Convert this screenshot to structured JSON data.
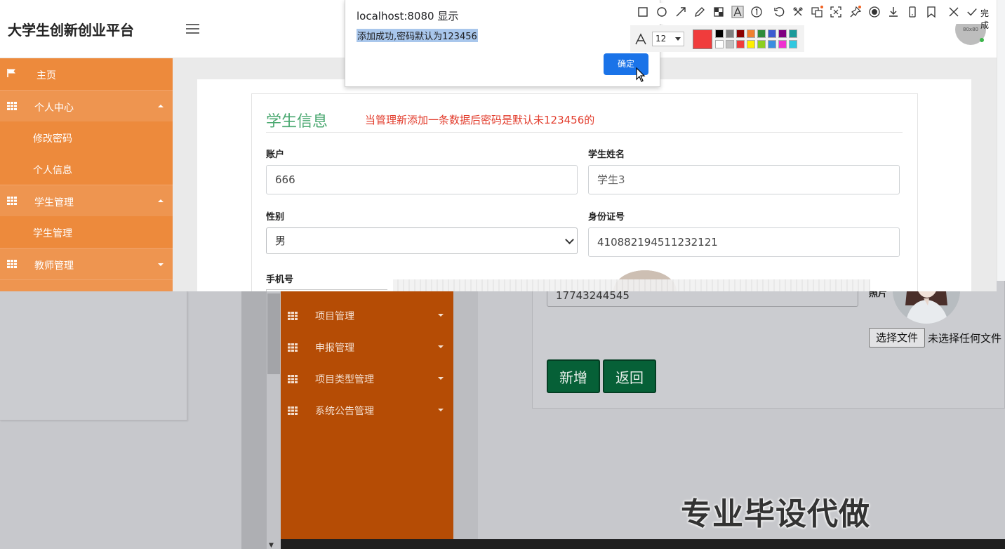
{
  "brand": "大学生创新创业平台",
  "avatar_text": "80x80",
  "sidebar": {
    "items": [
      {
        "label": "主页",
        "type": "head",
        "icon": "flag-icon"
      },
      {
        "label": "个人中心",
        "type": "head",
        "icon": "grid-icon",
        "caret": "up"
      },
      {
        "label": "修改密码",
        "type": "sub"
      },
      {
        "label": "个人信息",
        "type": "sub"
      },
      {
        "label": "学生管理",
        "type": "head",
        "icon": "grid-icon",
        "caret": "up"
      },
      {
        "label": "学生管理",
        "type": "sub"
      },
      {
        "label": "教师管理",
        "type": "head",
        "icon": "grid-icon",
        "caret": "down"
      }
    ]
  },
  "form": {
    "title": "学生信息",
    "note": "当管理新添加一条数据后密码是默认未123456的",
    "account_label": "账户",
    "account_value": "666",
    "name_label": "学生姓名",
    "name_value": "学生3",
    "gender_label": "性别",
    "gender_value": "男",
    "idcard_label": "身份证号",
    "idcard_value": "410882194511232121",
    "phone_label": "手机号"
  },
  "alert": {
    "title": "localhost:8080 显示",
    "message": "添加成功,密码默认为123456",
    "ok_label": "确定"
  },
  "snip": {
    "font_size": "12",
    "done_label": "完成",
    "active_color": "#f03c3c",
    "swatches": [
      "#000000",
      "#7f7f7f",
      "#8b0000",
      "#f08030",
      "#2e8b3a",
      "#3a5bd0",
      "#800080",
      "#1a9a9a",
      "#ffffff",
      "#c0c0c0",
      "#f03c3c",
      "#ffee00",
      "#8ccf20",
      "#3a8ee0",
      "#f030d0",
      "#30c8e0"
    ]
  },
  "background": {
    "sidebar_items": [
      "项目管理",
      "申报管理",
      "项目类型管理",
      "系统公告管理"
    ],
    "phone_value": "17743244545",
    "photo_label": "照片",
    "file_button": "选择文件",
    "file_status": "未选择任何文件",
    "add_button": "新增",
    "back_button": "返回"
  },
  "watermark": "专业毕设代做"
}
